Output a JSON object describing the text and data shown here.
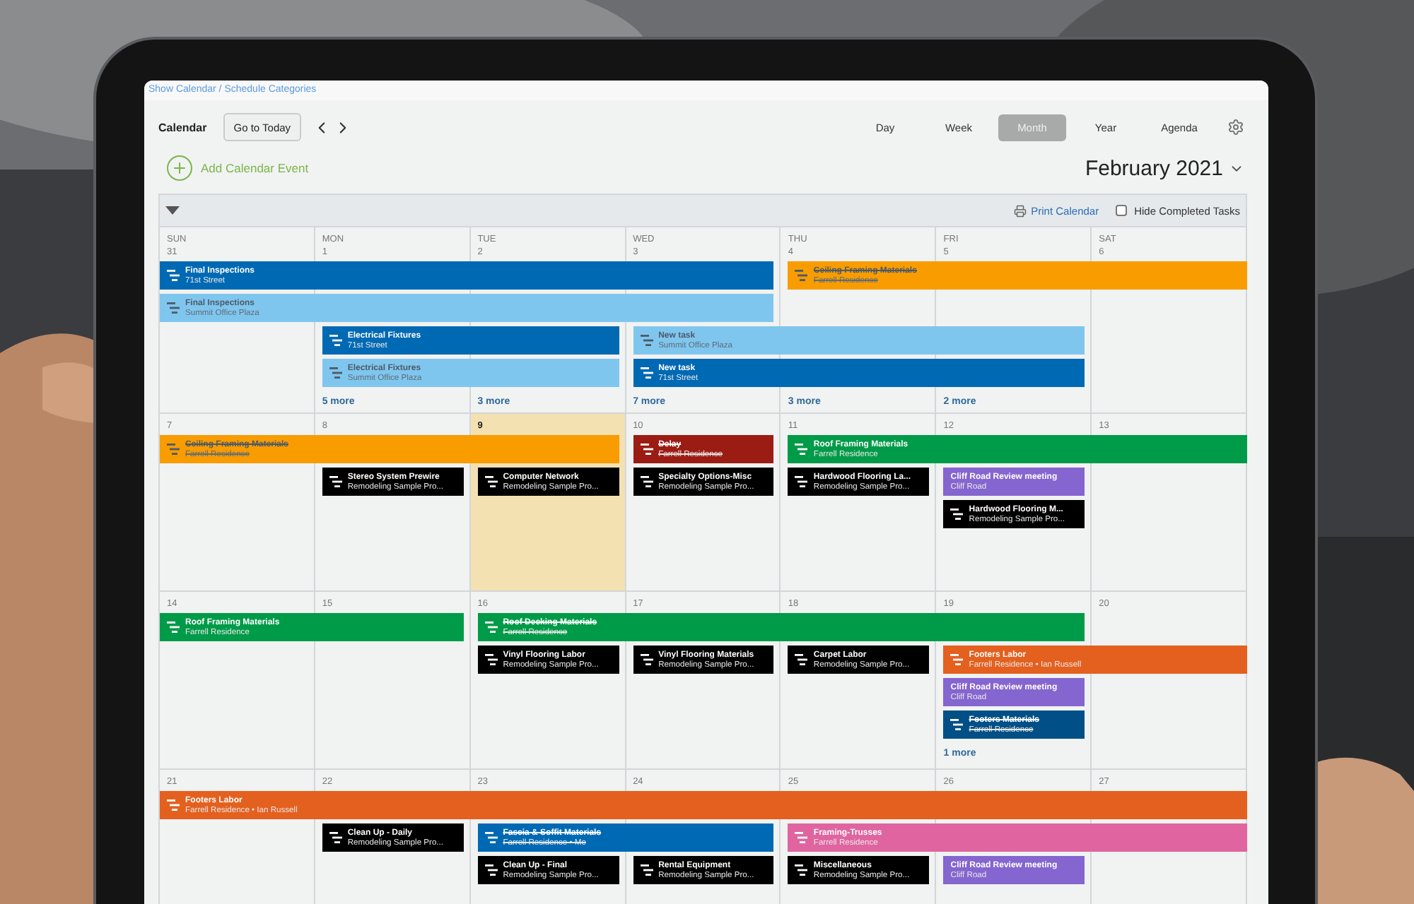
{
  "breadcrumb": "Show Calendar / Schedule Categories",
  "toolbar": {
    "title": "Calendar",
    "today_button": "Go to Today"
  },
  "views": [
    {
      "label": "Day",
      "selected": false
    },
    {
      "label": "Week",
      "selected": false
    },
    {
      "label": "Month",
      "selected": true
    },
    {
      "label": "Year",
      "selected": false
    },
    {
      "label": "Agenda",
      "selected": false
    }
  ],
  "add_event": "Add Calendar Event",
  "month_title": "February 2021",
  "print": "Print Calendar",
  "hide_completed": {
    "label": "Hide Completed Tasks",
    "checked": false
  },
  "weeks": [
    {
      "days": [
        {
          "weekday": "SUN",
          "date": "31",
          "today": false
        },
        {
          "weekday": "MON",
          "date": "1",
          "today": false,
          "more": "5 more"
        },
        {
          "weekday": "TUE",
          "date": "2",
          "today": false,
          "more": "3 more"
        },
        {
          "weekday": "WED",
          "date": "3",
          "today": false,
          "more": "7 more"
        },
        {
          "weekday": "THU",
          "date": "4",
          "today": false,
          "more": "3 more"
        },
        {
          "weekday": "FRI",
          "date": "5",
          "today": false,
          "more": "2 more"
        },
        {
          "weekday": "SAT",
          "date": "6",
          "today": false
        }
      ],
      "lanes": [
        [
          {
            "kind": "task",
            "title": "Final Inspections",
            "subtitle": "71st Street",
            "color": "#0069b4",
            "done": false
          },
          {
            "kind": "continuation"
          },
          {
            "kind": "continuation"
          },
          {
            "kind": "continuation"
          },
          {
            "kind": "task",
            "title": "Ceiling Framing Materials",
            "subtitle": "Farrell Residence",
            "color": "#f89c00",
            "done": true
          },
          {
            "kind": "continuation"
          },
          {
            "kind": "continuation"
          }
        ],
        [
          {
            "kind": "task",
            "title": "Final Inspections",
            "subtitle": "Summit Office Plaza",
            "color": "#7fc6ee",
            "done": false
          },
          {
            "kind": "continuation"
          },
          {
            "kind": "continuation"
          },
          {
            "kind": "continuation"
          },
          {
            "kind": "free"
          },
          {
            "kind": "free"
          },
          {
            "kind": "free"
          }
        ],
        [
          {
            "kind": "free"
          },
          {
            "kind": "task",
            "title": "Electrical Fixtures",
            "subtitle": "71st Street",
            "color": "#0069b4",
            "done": false
          },
          {
            "kind": "continuation"
          },
          {
            "kind": "task",
            "title": "New task",
            "subtitle": "Summit Office Plaza",
            "color": "#7fc6ee",
            "done": false
          },
          {
            "kind": "continuation"
          },
          {
            "kind": "continuation"
          },
          {
            "kind": "free"
          }
        ],
        [
          {
            "kind": "free"
          },
          {
            "kind": "task",
            "title": "Electrical Fixtures",
            "subtitle": "Summit Office Plaza",
            "color": "#7fc6ee",
            "done": false
          },
          {
            "kind": "continuation"
          },
          {
            "kind": "task",
            "title": "New task",
            "subtitle": "71st Street",
            "color": "#0069b4",
            "done": false
          },
          {
            "kind": "continuation"
          },
          {
            "kind": "continuation"
          },
          {
            "kind": "free"
          }
        ]
      ]
    },
    {
      "days": [
        {
          "date": "7",
          "today": false
        },
        {
          "date": "8",
          "today": false
        },
        {
          "date": "9",
          "today": true
        },
        {
          "date": "10",
          "today": false
        },
        {
          "date": "11",
          "today": false
        },
        {
          "date": "12",
          "today": false
        },
        {
          "date": "13",
          "today": false
        }
      ],
      "lanes": [
        [
          {
            "kind": "task",
            "title": "Ceiling Framing Materials",
            "subtitle": "Farrell Residence",
            "color": "#f89c00",
            "done": true
          },
          {
            "kind": "continuation"
          },
          {
            "kind": "continuation"
          },
          {
            "kind": "task",
            "title": "Delay",
            "subtitle": "Farrell Residence",
            "color": "#9b1c12",
            "done": true
          },
          {
            "kind": "task",
            "title": "Roof Framing Materials",
            "subtitle": "Farrell Residence",
            "color": "#009b48",
            "done": false
          },
          {
            "kind": "continuation"
          },
          {
            "kind": "continuation"
          }
        ],
        [
          {
            "kind": "free"
          },
          {
            "kind": "task",
            "title": "Stereo System Prewire",
            "subtitle": "Remodeling Sample Pro...",
            "color": "#000000",
            "done": false
          },
          {
            "kind": "task",
            "title": "Computer Network",
            "subtitle": "Remodeling Sample Pro...",
            "color": "#000000",
            "done": false
          },
          {
            "kind": "task",
            "title": "Specialty Options-Misc",
            "subtitle": "Remodeling Sample Pro...",
            "color": "#000000",
            "done": false
          },
          {
            "kind": "task",
            "title": "Hardwood Flooring La...",
            "subtitle": "Remodeling Sample Pro...",
            "color": "#000000",
            "done": false
          },
          {
            "kind": "meeting",
            "title": "Cliff Road Review meeting",
            "subtitle": "Cliff Road",
            "color": "#8565cf",
            "done": false
          },
          {
            "kind": "free"
          }
        ],
        [
          {
            "kind": "free"
          },
          {
            "kind": "free"
          },
          {
            "kind": "free"
          },
          {
            "kind": "free"
          },
          {
            "kind": "free"
          },
          {
            "kind": "task",
            "title": "Hardwood Flooring M...",
            "subtitle": "Remodeling Sample Pro...",
            "color": "#000000",
            "done": false
          },
          {
            "kind": "free"
          }
        ]
      ]
    },
    {
      "days": [
        {
          "date": "14",
          "today": false
        },
        {
          "date": "15",
          "today": false
        },
        {
          "date": "16",
          "today": false
        },
        {
          "date": "17",
          "today": false
        },
        {
          "date": "18",
          "today": false
        },
        {
          "date": "19",
          "today": false,
          "more": "1 more"
        },
        {
          "date": "20",
          "today": false
        }
      ],
      "lanes": [
        [
          {
            "kind": "task",
            "title": "Roof Framing Materials",
            "subtitle": "Farrell Residence",
            "color": "#009b48",
            "done": false
          },
          {
            "kind": "continuation"
          },
          {
            "kind": "task",
            "title": "Roof Decking Materials",
            "subtitle": "Farrell Residence",
            "color": "#009b48",
            "done": true
          },
          {
            "kind": "continuation"
          },
          {
            "kind": "continuation"
          },
          {
            "kind": "continuation"
          },
          {
            "kind": "free"
          }
        ],
        [
          {
            "kind": "free"
          },
          {
            "kind": "free"
          },
          {
            "kind": "task",
            "title": "Vinyl Flooring Labor",
            "subtitle": "Remodeling Sample Pro...",
            "color": "#000000",
            "done": false
          },
          {
            "kind": "task",
            "title": "Vinyl Flooring Materials",
            "subtitle": "Remodeling Sample Pro...",
            "color": "#000000",
            "done": false
          },
          {
            "kind": "task",
            "title": "Carpet Labor",
            "subtitle": "Remodeling Sample Pro...",
            "color": "#000000",
            "done": false
          },
          {
            "kind": "task",
            "title": "Footers Labor",
            "subtitle": "Farrell Residence • Ian Russell",
            "color": "#e4601e",
            "done": false
          },
          {
            "kind": "continuation"
          }
        ],
        [
          {
            "kind": "free"
          },
          {
            "kind": "free"
          },
          {
            "kind": "free"
          },
          {
            "kind": "free"
          },
          {
            "kind": "free"
          },
          {
            "kind": "meeting",
            "title": "Cliff Road Review meeting",
            "subtitle": "Cliff Road",
            "color": "#8565cf",
            "done": false
          },
          {
            "kind": "free"
          }
        ],
        [
          {
            "kind": "free"
          },
          {
            "kind": "free"
          },
          {
            "kind": "free"
          },
          {
            "kind": "free"
          },
          {
            "kind": "free"
          },
          {
            "kind": "task",
            "title": "Footers Materials",
            "subtitle": "Farrell Residence",
            "color": "#004f86",
            "done": true
          },
          {
            "kind": "free"
          }
        ]
      ]
    },
    {
      "days": [
        {
          "date": "21",
          "today": false
        },
        {
          "date": "22",
          "today": false
        },
        {
          "date": "23",
          "today": false
        },
        {
          "date": "24",
          "today": false
        },
        {
          "date": "25",
          "today": false
        },
        {
          "date": "26",
          "today": false
        },
        {
          "date": "27",
          "today": false
        }
      ],
      "lanes": [
        [
          {
            "kind": "task",
            "title": "Footers Labor",
            "subtitle": "Farrell Residence • Ian Russell",
            "color": "#e4601e",
            "done": false
          },
          {
            "kind": "continuation"
          },
          {
            "kind": "continuation"
          },
          {
            "kind": "continuation"
          },
          {
            "kind": "continuation"
          },
          {
            "kind": "continuation"
          },
          {
            "kind": "continuation"
          }
        ],
        [
          {
            "kind": "free"
          },
          {
            "kind": "task",
            "title": "Clean Up - Daily",
            "subtitle": "Remodeling Sample Pro...",
            "color": "#000000",
            "done": false
          },
          {
            "kind": "task",
            "title": "Fascia & Soffit Materials",
            "subtitle": "Farrell Residence • Me",
            "color": "#0069b4",
            "done": true
          },
          {
            "kind": "continuation"
          },
          {
            "kind": "task",
            "title": "Framing-Trusses",
            "subtitle": "Farrell Residence",
            "color": "#e0649f",
            "done": false
          },
          {
            "kind": "continuation"
          },
          {
            "kind": "continuation"
          }
        ],
        [
          {
            "kind": "free"
          },
          {
            "kind": "free"
          },
          {
            "kind": "task",
            "title": "Clean Up - Final",
            "subtitle": "Remodeling Sample Pro...",
            "color": "#000000",
            "done": false
          },
          {
            "kind": "task",
            "title": "Rental Equipment",
            "subtitle": "Remodeling Sample Pro...",
            "color": "#000000",
            "done": false
          },
          {
            "kind": "task",
            "title": "Miscellaneous",
            "subtitle": "Remodeling Sample Pro...",
            "color": "#000000",
            "done": false
          },
          {
            "kind": "meeting",
            "title": "Cliff Road Review meeting",
            "subtitle": "Cliff Road",
            "color": "#8565cf",
            "done": false
          },
          {
            "kind": "free"
          }
        ]
      ]
    }
  ]
}
